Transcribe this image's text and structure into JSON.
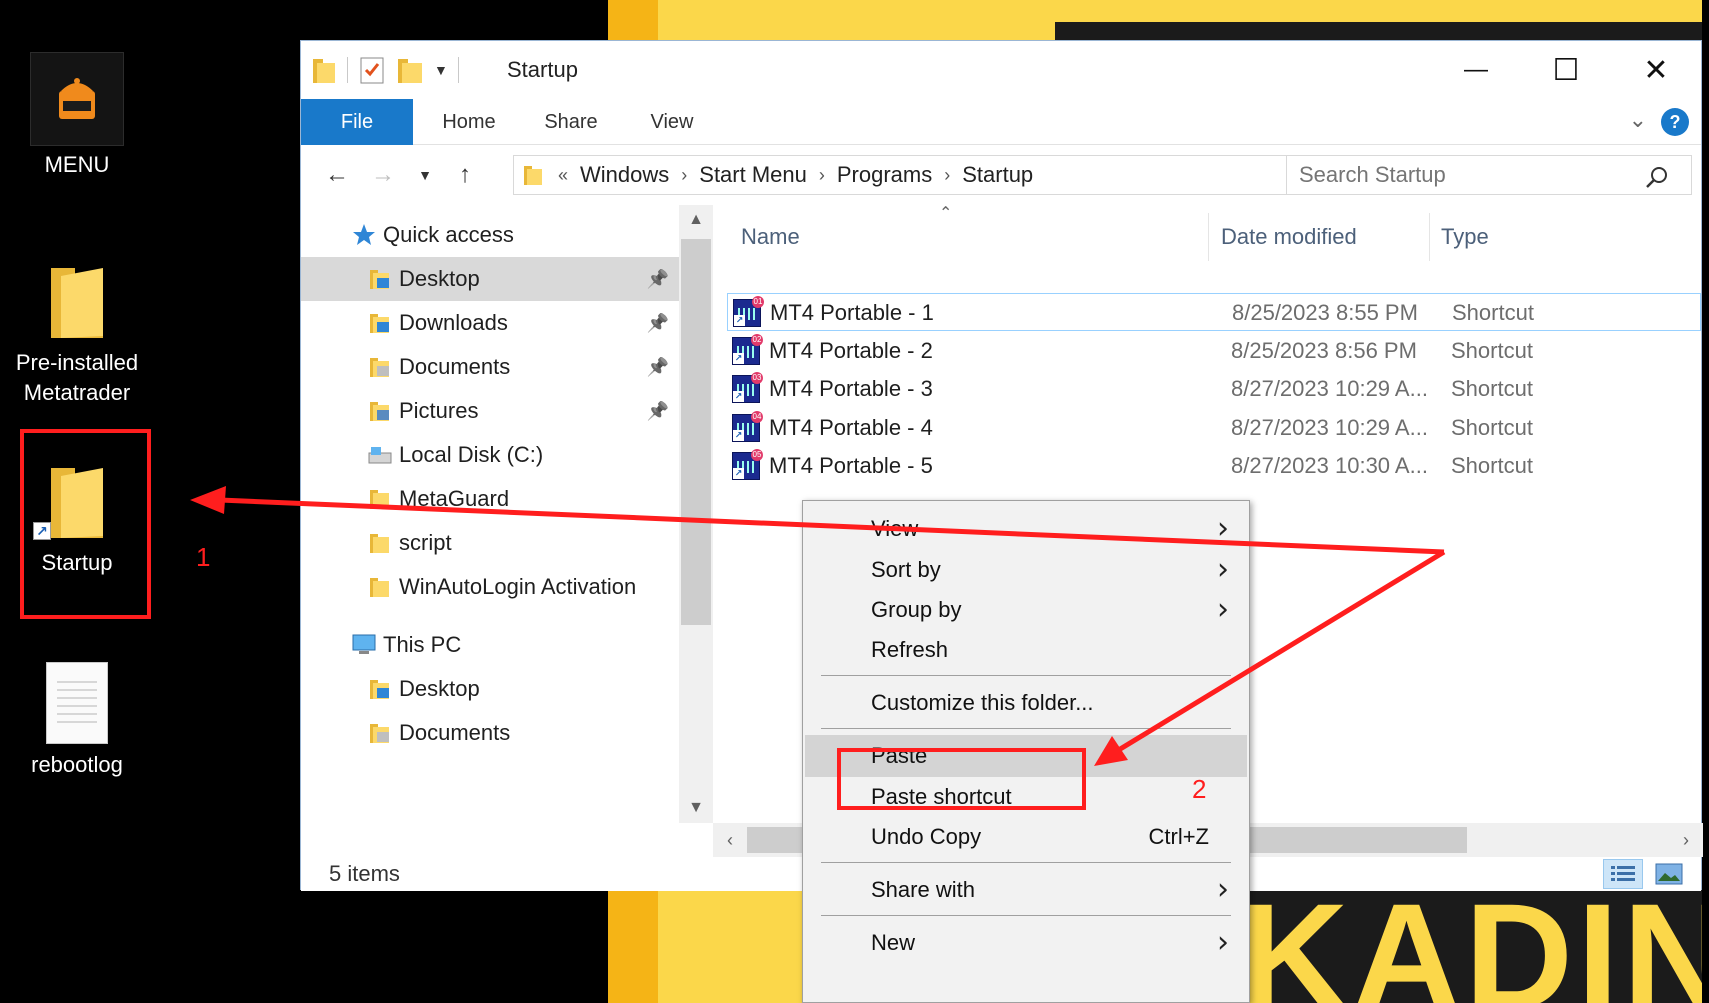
{
  "desktop": {
    "icons": [
      {
        "label": "MENU",
        "badge": "MENU"
      },
      {
        "label_lines": [
          "Pre-installed",
          "Metatrader"
        ]
      },
      {
        "label": "Startup"
      },
      {
        "label": "rebootlog"
      }
    ]
  },
  "window": {
    "title": "Startup",
    "controls": {
      "minimize": "—",
      "maximize": "☐",
      "close": "✕"
    },
    "ribbon_tabs": [
      "File",
      "Home",
      "Share",
      "View"
    ],
    "help": "?",
    "address": {
      "overflow": "«",
      "crumbs": [
        "Windows",
        "Start Menu",
        "Programs",
        "Startup"
      ]
    },
    "search_placeholder": "Search Startup"
  },
  "nav_pane": {
    "items": [
      {
        "label": "Quick access",
        "icon": "star-icon",
        "level": 0,
        "pinned": false,
        "selected": false
      },
      {
        "label": "Desktop",
        "icon": "desktop-folder-icon",
        "level": 1,
        "pinned": true,
        "selected": true
      },
      {
        "label": "Downloads",
        "icon": "downloads-folder-icon",
        "level": 1,
        "pinned": true,
        "selected": false
      },
      {
        "label": "Documents",
        "icon": "documents-folder-icon",
        "level": 1,
        "pinned": true,
        "selected": false
      },
      {
        "label": "Pictures",
        "icon": "pictures-folder-icon",
        "level": 1,
        "pinned": true,
        "selected": false
      },
      {
        "label": "Local Disk (C:)",
        "icon": "drive-icon",
        "level": 1,
        "pinned": false,
        "selected": false
      },
      {
        "label": "MetaGuard",
        "icon": "folder-icon",
        "level": 1,
        "pinned": false,
        "selected": false
      },
      {
        "label": "script",
        "icon": "folder-icon",
        "level": 1,
        "pinned": false,
        "selected": false
      },
      {
        "label": "WinAutoLogin Activation",
        "icon": "folder-icon",
        "level": 1,
        "pinned": false,
        "selected": false
      },
      {
        "label": "This PC",
        "icon": "computer-icon",
        "level": 0,
        "pinned": false,
        "selected": false
      },
      {
        "label": "Desktop",
        "icon": "desktop-folder-icon",
        "level": 1,
        "pinned": false,
        "selected": false
      },
      {
        "label": "Documents",
        "icon": "documents-folder-icon",
        "level": 1,
        "pinned": false,
        "selected": false
      }
    ]
  },
  "file_list": {
    "columns": [
      "Name",
      "Date modified",
      "Type"
    ],
    "rows": [
      {
        "name": "MT4 Portable - 1",
        "date": "8/25/2023 8:55 PM",
        "type": "Shortcut",
        "badge": "01"
      },
      {
        "name": "MT4 Portable - 2",
        "date": "8/25/2023 8:56 PM",
        "type": "Shortcut",
        "badge": "02"
      },
      {
        "name": "MT4 Portable - 3",
        "date": "8/27/2023 10:29 A...",
        "type": "Shortcut",
        "badge": "03"
      },
      {
        "name": "MT4 Portable - 4",
        "date": "8/27/2023 10:29 A...",
        "type": "Shortcut",
        "badge": "04"
      },
      {
        "name": "MT4 Portable - 5",
        "date": "8/27/2023 10:30 A...",
        "type": "Shortcut",
        "badge": "05"
      }
    ]
  },
  "status": {
    "items": "5 items"
  },
  "context_menu": {
    "items": [
      {
        "label": "View",
        "submenu": true
      },
      {
        "label": "Sort by",
        "submenu": true
      },
      {
        "label": "Group by",
        "submenu": true
      },
      {
        "label": "Refresh"
      },
      {
        "label": "Customize this folder..."
      },
      {
        "label": "Paste",
        "highlight": true
      },
      {
        "label": "Paste shortcut"
      },
      {
        "label": "Undo Copy",
        "shortcut": "Ctrl+Z"
      },
      {
        "label": "Share with",
        "submenu": true
      },
      {
        "label": "New",
        "submenu": true
      }
    ]
  },
  "annotations": {
    "step1": "1",
    "step2": "2",
    "color": "#ff1e1e"
  },
  "background_text": "KADIN"
}
